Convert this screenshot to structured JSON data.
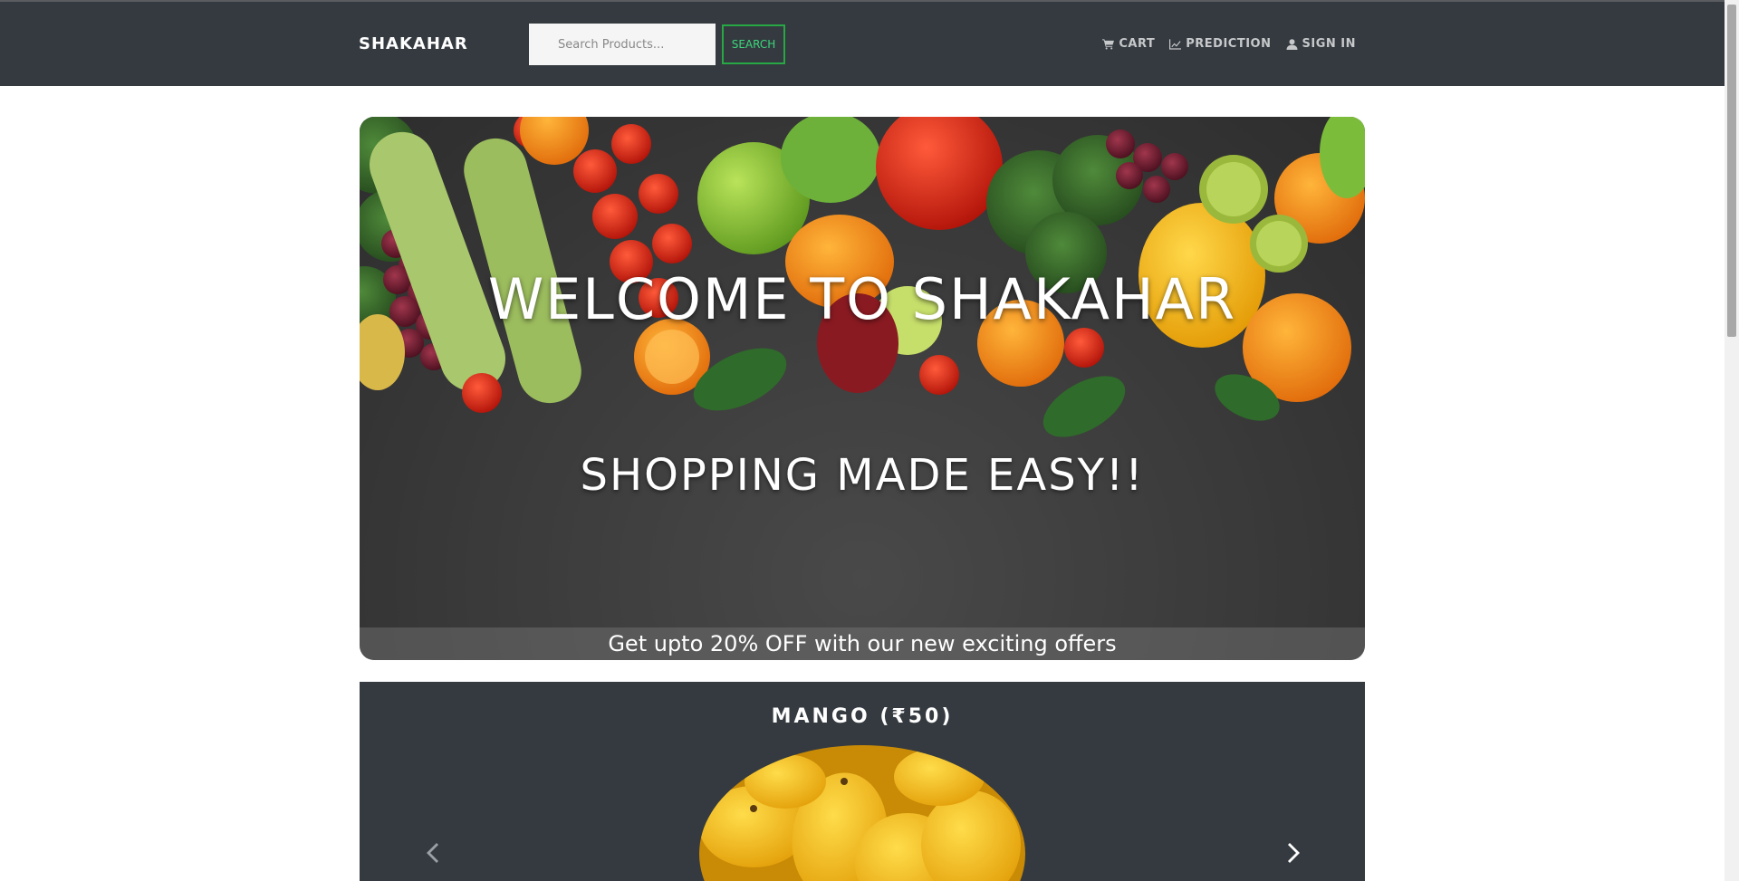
{
  "navbar": {
    "brand": "SHAKAHAR",
    "search": {
      "placeholder": "Search Products...",
      "value": ""
    },
    "search_button": "SEARCH",
    "links": [
      {
        "label": "CART",
        "icon": "cart-icon"
      },
      {
        "label": "PREDICTION",
        "icon": "chart-icon"
      },
      {
        "label": "SIGN IN",
        "icon": "user-icon"
      }
    ]
  },
  "hero": {
    "title": "WELCOME TO SHAKAHAR",
    "subtitle": "SHOPPING MADE EASY!!",
    "offer": "Get upto 20% OFF with our new exciting offers"
  },
  "carousel": {
    "current_item": "MANGO (₹50)",
    "prev_icon": "chevron-left-icon",
    "next_icon": "chevron-right-icon"
  },
  "colors": {
    "navbar_bg": "#343a40",
    "accent_green": "#28a745",
    "hero_bg": "#3b3b3b"
  }
}
